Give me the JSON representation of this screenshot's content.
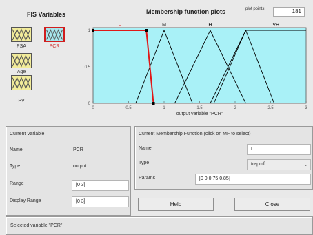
{
  "fis": {
    "title": "FIS Variables",
    "variables": [
      {
        "name": "PSA",
        "active": false
      },
      {
        "name": "PCR",
        "active": true
      },
      {
        "name": "Age",
        "active": false
      },
      {
        "name": "PV",
        "active": false
      }
    ]
  },
  "plot": {
    "title": "Membership function plots",
    "plot_points_label": "plot points:",
    "plot_points_value": "181",
    "xlabel": "output variable \"PCR\"",
    "x_ticks": [
      "0",
      "0.5",
      "1",
      "1.5",
      "2",
      "2.5",
      "3"
    ],
    "y_ticks": [
      "0",
      "0.5",
      "1"
    ],
    "colors": {
      "background": "#a9f1f7",
      "selected": "#e01818",
      "other": "#000000"
    }
  },
  "chart_data": {
    "type": "line",
    "xlim": [
      0,
      3
    ],
    "ylim": [
      0,
      1
    ],
    "series": [
      {
        "name": "L",
        "shape": "trapmf",
        "points": [
          [
            0,
            1
          ],
          [
            0.75,
            1
          ],
          [
            0.85,
            0
          ]
        ],
        "selected": true
      },
      {
        "name": "M",
        "shape": "trimf",
        "points": [
          [
            0.6,
            0
          ],
          [
            1.0,
            1
          ],
          [
            1.4,
            0
          ]
        ],
        "selected": false
      },
      {
        "name": "H",
        "shape": "trimf",
        "points": [
          [
            1.15,
            0
          ],
          [
            1.65,
            1
          ],
          [
            2.15,
            0
          ]
        ],
        "selected": false
      },
      {
        "name": "VH",
        "shape": "trapmf",
        "points": [
          [
            1.7,
            0
          ],
          [
            2.15,
            1
          ],
          [
            3,
            1
          ]
        ],
        "selected": false
      }
    ],
    "extra_lines": [
      {
        "points": [
          [
            1.65,
            0
          ],
          [
            2.15,
            1
          ]
        ]
      },
      {
        "points": [
          [
            2.15,
            1
          ],
          [
            2.55,
            0
          ]
        ]
      }
    ]
  },
  "current_variable": {
    "heading": "Current Variable",
    "name_label": "Name",
    "name_value": "PCR",
    "type_label": "Type",
    "type_value": "output",
    "range_label": "Range",
    "range_value": "[0 3]",
    "display_range_label": "Display Range",
    "display_range_value": "[0 3]"
  },
  "current_mf": {
    "heading": "Current Membership Function (click on MF to select)",
    "name_label": "Name",
    "name_value": "L",
    "type_label": "Type",
    "type_value": "trapmf",
    "params_label": "Params",
    "params_value": "[0 0 0.75 0.85]"
  },
  "buttons": {
    "help": "Help",
    "close": "Close"
  },
  "status": "Selected variable \"PCR\""
}
